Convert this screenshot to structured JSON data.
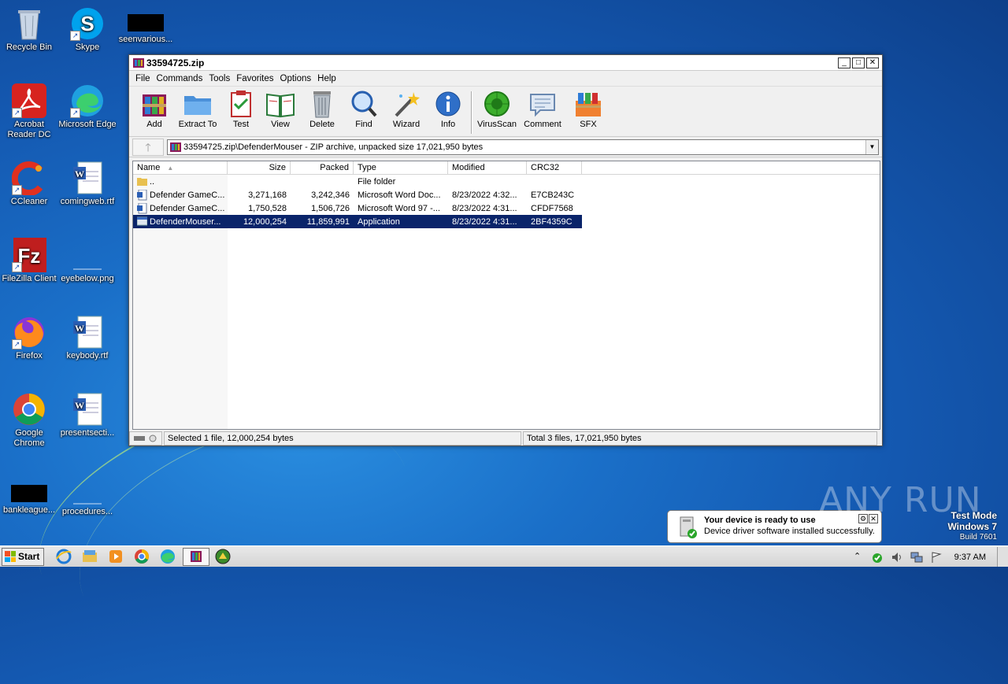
{
  "desktop": {
    "icons": [
      {
        "label": "Recycle Bin"
      },
      {
        "label": "Skype"
      },
      {
        "label": "seenvarious..."
      },
      {
        "label": "Acrobat Reader DC"
      },
      {
        "label": "Microsoft Edge"
      },
      {
        "label": "CCleaner"
      },
      {
        "label": "comingweb.rtf"
      },
      {
        "label": "FileZilla Client"
      },
      {
        "label": "eyebelow.png"
      },
      {
        "label": "Firefox"
      },
      {
        "label": "keybody.rtf"
      },
      {
        "label": "Google Chrome"
      },
      {
        "label": "presentsecti..."
      },
      {
        "label": "bankleague..."
      },
      {
        "label": "procedures..."
      }
    ]
  },
  "window": {
    "title": "33594725.zip",
    "controls": {
      "minimize": "_",
      "maximize": "□",
      "close": "✕"
    },
    "menu": [
      "File",
      "Commands",
      "Tools",
      "Favorites",
      "Options",
      "Help"
    ],
    "toolbar": [
      "Add",
      "Extract To",
      "Test",
      "View",
      "Delete",
      "Find",
      "Wizard",
      "Info",
      "VirusScan",
      "Comment",
      "SFX"
    ],
    "address": "33594725.zip\\DefenderMouser - ZIP archive, unpacked size 17,021,950 bytes",
    "columns": {
      "name": "Name",
      "size": "Size",
      "packed": "Packed",
      "type": "Type",
      "modified": "Modified",
      "crc": "CRC32"
    },
    "rows": [
      {
        "name": "..",
        "size": "",
        "packed": "",
        "type": "File folder",
        "modified": "",
        "crc": "",
        "icon": "folder-icon"
      },
      {
        "name": "Defender GameC...",
        "size": "3,271,168",
        "packed": "3,242,346",
        "type": "Microsoft Word Doc...",
        "modified": "8/23/2022 4:32...",
        "crc": "E7CB243C",
        "icon": "word-doc-icon"
      },
      {
        "name": "Defender GameC...",
        "size": "1,750,528",
        "packed": "1,506,726",
        "type": "Microsoft Word 97 -...",
        "modified": "8/23/2022 4:31...",
        "crc": "CFDF7568",
        "icon": "word-doc-icon"
      },
      {
        "name": "DefenderMouser...",
        "size": "12,000,254",
        "packed": "11,859,991",
        "type": "Application",
        "modified": "8/23/2022 4:31...",
        "crc": "2BF4359C",
        "icon": "application-icon"
      }
    ],
    "status_left": "Selected 1 file, 12,000,254 bytes",
    "status_right": "Total 3 files, 17,021,950 bytes"
  },
  "notification": {
    "title": "Your device is ready to use",
    "text": "Device driver software installed successfully."
  },
  "watermark": {
    "brand": "ANY RUN",
    "line1": "Test Mode",
    "line2": "Windows 7",
    "line3": "Build 7601"
  },
  "taskbar": {
    "start_label": "Start",
    "clock": "9:37 AM"
  }
}
